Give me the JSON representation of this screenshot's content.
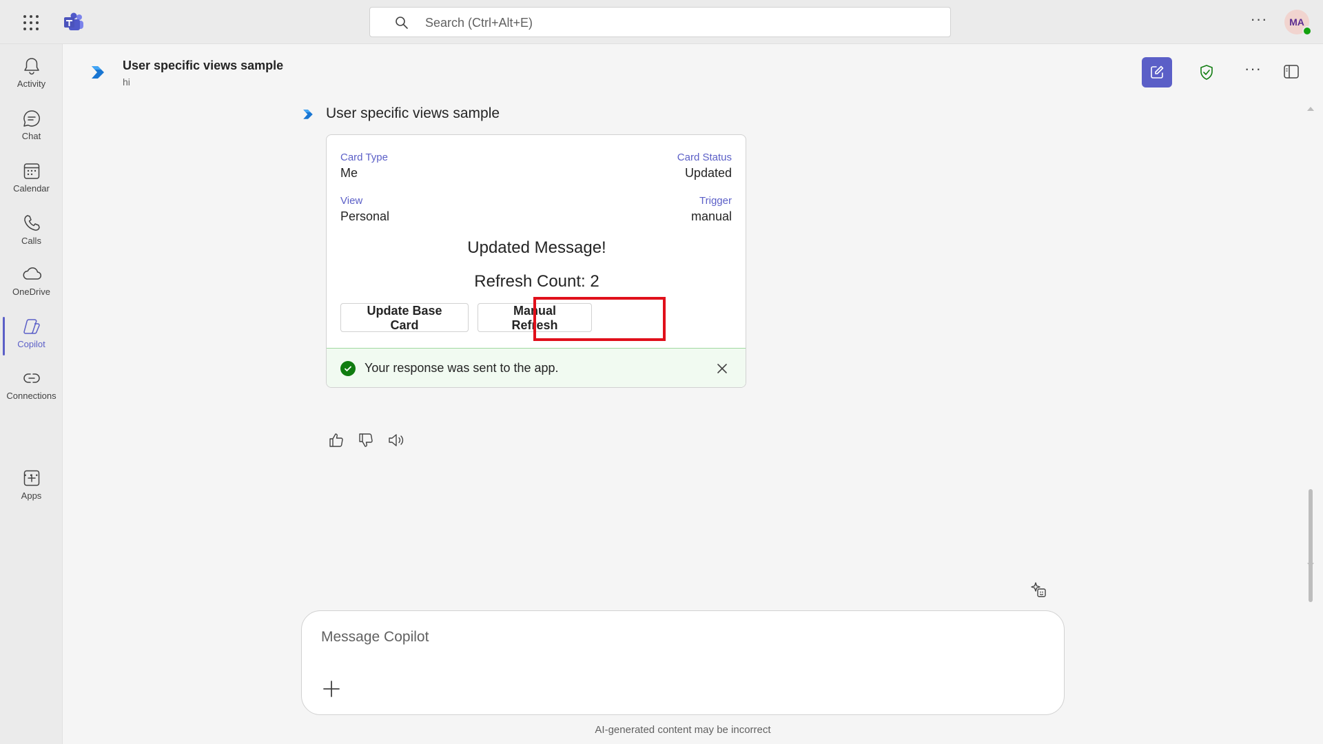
{
  "topbar": {
    "search_placeholder": "Search (Ctrl+Alt+E)",
    "avatar_initials": "MA"
  },
  "rail": {
    "items": [
      {
        "label": "Activity",
        "icon": "bell-icon"
      },
      {
        "label": "Chat",
        "icon": "chat-icon"
      },
      {
        "label": "Calendar",
        "icon": "calendar-icon"
      },
      {
        "label": "Calls",
        "icon": "phone-icon"
      },
      {
        "label": "OneDrive",
        "icon": "cloud-icon"
      },
      {
        "label": "Copilot",
        "icon": "copilot-icon",
        "active": true
      },
      {
        "label": "Connections",
        "icon": "connections-icon"
      },
      {
        "label": "Apps",
        "icon": "add-app-icon"
      }
    ]
  },
  "header": {
    "title": "User specific views sample",
    "subtitle": "hi"
  },
  "message": {
    "sender": "User specific views sample",
    "card": {
      "facts": {
        "card_type_label": "Card Type",
        "card_type_value": "Me",
        "card_status_label": "Card Status",
        "card_status_value": "Updated",
        "view_label": "View",
        "view_value": "Personal",
        "trigger_label": "Trigger",
        "trigger_value": "manual"
      },
      "updated_message": "Updated Message!",
      "refresh_count": "Refresh Count: 2",
      "buttons": {
        "update_base": "Update Base Card",
        "manual_refresh": "Manual Refresh"
      },
      "toast": "Your response was sent to the app."
    }
  },
  "composer": {
    "placeholder": "Message Copilot",
    "disclaimer": "AI-generated content may be incorrect"
  },
  "colors": {
    "accent": "#5b5fc7",
    "highlight": "#e0101b",
    "success": "#107c10"
  }
}
